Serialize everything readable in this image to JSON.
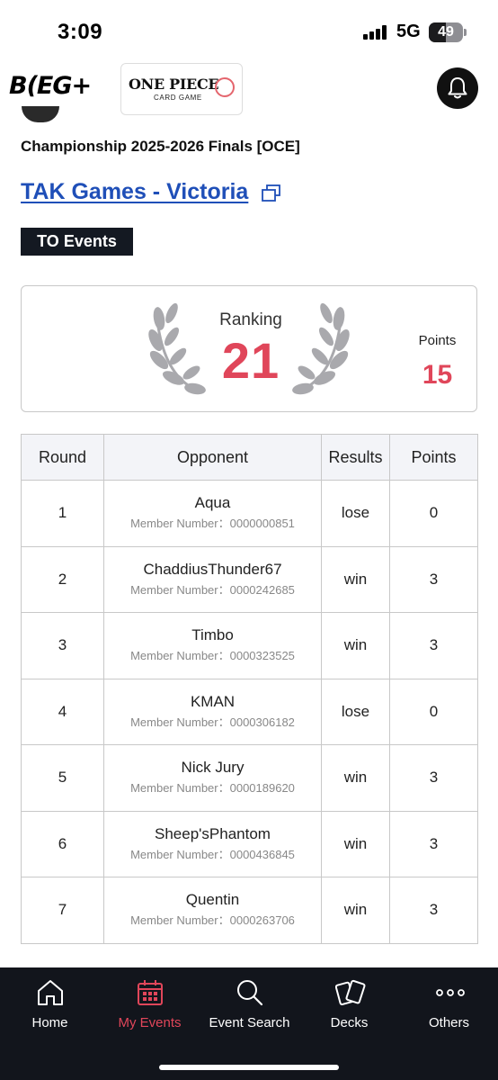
{
  "status_bar": {
    "time": "3:09",
    "network": "5G",
    "battery": "49",
    "battery_level": 0.49,
    "icons": [
      "signal-icon",
      "battery-icon"
    ]
  },
  "header": {
    "brand_logo": "B(EG+",
    "game_logo_main": "ONE PIECE",
    "game_logo_sub": "CARD GAME",
    "icons": [
      "bell-icon"
    ]
  },
  "event": {
    "title": "Championship 2025-2026 Finals [OCE]",
    "venue": "TAK Games - Victoria",
    "tag": "TO Events"
  },
  "ranking": {
    "label": "Ranking",
    "value": "21",
    "points_label": "Points",
    "points_value": "15"
  },
  "table": {
    "headers": {
      "round": "Round",
      "opponent": "Opponent",
      "results": "Results",
      "points": "Points"
    },
    "rows": [
      {
        "round": "1",
        "name": "Aqua",
        "member": "Member Number：0000000851",
        "result": "lose",
        "points": "0"
      },
      {
        "round": "2",
        "name": "ChaddiusThunder67",
        "member": "Member Number：0000242685",
        "result": "win",
        "points": "3"
      },
      {
        "round": "3",
        "name": "Timbo",
        "member": "Member Number：0000323525",
        "result": "win",
        "points": "3"
      },
      {
        "round": "4",
        "name": "KMAN",
        "member": "Member Number：0000306182",
        "result": "lose",
        "points": "0"
      },
      {
        "round": "5",
        "name": "Nick Jury",
        "member": "Member Number：0000189620",
        "result": "win",
        "points": "3"
      },
      {
        "round": "6",
        "name": "Sheep'sPhantom",
        "member": "Member Number：0000436845",
        "result": "win",
        "points": "3"
      },
      {
        "round": "7",
        "name": "Quentin",
        "member": "Member Number：0000263706",
        "result": "win",
        "points": "3"
      }
    ]
  },
  "nav": {
    "items": [
      {
        "label": "Home",
        "icon": "home-icon"
      },
      {
        "label": "My Events",
        "icon": "calendar-icon",
        "active": true
      },
      {
        "label": "Event Search",
        "icon": "search-icon"
      },
      {
        "label": "Decks",
        "icon": "cards-icon"
      },
      {
        "label": "Others",
        "icon": "more-icon"
      }
    ]
  },
  "colors": {
    "accent": "#e0465a",
    "link": "#1f4fb8",
    "nav_bg": "#12151c",
    "tag_bg": "#141922"
  }
}
